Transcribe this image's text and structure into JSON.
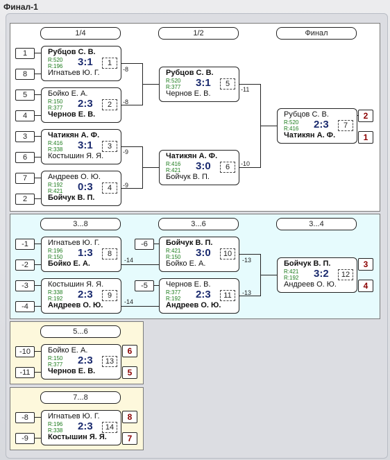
{
  "window_title": "Финал-1",
  "sec1": {
    "headers": [
      "1/4",
      "1/2",
      "Финал"
    ],
    "seeds": [
      "1",
      "8",
      "5",
      "4",
      "3",
      "6",
      "7",
      "2"
    ],
    "qf1": {
      "p1": "Рубцов С. В.",
      "p2": "Игнатьев Ю. Г.",
      "r1": "R:520",
      "r2": "R:196",
      "score": "3:1",
      "num": "1",
      "lbl": "-8"
    },
    "qf2": {
      "p1": "Бойко Е. А.",
      "p2": "Чернов Е. В.",
      "r1": "R:150",
      "r2": "R:377",
      "score": "2:3",
      "num": "2",
      "lbl": "-8"
    },
    "qf3": {
      "p1": "Чатикян А. Ф.",
      "p2": "Костышин Я. Я.",
      "r1": "R:416",
      "r2": "R:338",
      "score": "3:1",
      "num": "3",
      "lbl": "-9"
    },
    "qf4": {
      "p1": "Андреев О. Ю.",
      "p2": "Бойчук В. П.",
      "r1": "R:192",
      "r2": "R:421",
      "score": "0:3",
      "num": "4",
      "lbl": "-9"
    },
    "sf1": {
      "p1": "Рубцов С. В.",
      "p2": "Чернов Е. В.",
      "r1": "R:520",
      "r2": "R:377",
      "score": "3:1",
      "num": "5",
      "lbl": "-11"
    },
    "sf2": {
      "p1": "Чатикян А. Ф.",
      "p2": "Бойчук В. П.",
      "r1": "R:416",
      "r2": "R:421",
      "score": "3:0",
      "num": "6",
      "lbl": "-10"
    },
    "final": {
      "p1": "Рубцов С. В.",
      "p2": "Чатикян А. Ф.",
      "r1": "R:520",
      "r2": "R:416",
      "score": "2:3",
      "num": "7",
      "place1": "2",
      "place2": "1"
    }
  },
  "sec2": {
    "headers": [
      "3...8",
      "3...6",
      "3...4"
    ],
    "seeds": [
      "-1",
      "-2",
      "-3",
      "-4",
      "-6",
      "-5"
    ],
    "m8": {
      "p1": "Игнатьев Ю. Г.",
      "p2": "Бойко Е. А.",
      "r1": "R:196",
      "r2": "R:150",
      "score": "1:3",
      "num": "8",
      "lbl": "-14"
    },
    "m9": {
      "p1": "Костышин Я. Я.",
      "p2": "Андреев О. Ю.",
      "r1": "R:338",
      "r2": "R:192",
      "score": "2:3",
      "num": "9",
      "lbl": "-14"
    },
    "m10": {
      "p1": "Бойчук В. П.",
      "p2": "Бойко Е. А.",
      "r1": "R:421",
      "r2": "R:150",
      "score": "3:0",
      "num": "10",
      "lbl": "-13"
    },
    "m11": {
      "p1": "Чернов Е. В.",
      "p2": "Андреев О. Ю.",
      "r1": "R:377",
      "r2": "R:192",
      "score": "2:3",
      "num": "11",
      "lbl": "-13"
    },
    "m12": {
      "p1": "Бойчук В. П.",
      "p2": "Андреев О. Ю.",
      "r1": "R:421",
      "r2": "R:192",
      "score": "3:2",
      "num": "12",
      "place1": "3",
      "place2": "4"
    }
  },
  "sec3": {
    "header": "5...6",
    "seeds": [
      "-10",
      "-11"
    ],
    "m13": {
      "p1": "Бойко Е. А.",
      "p2": "Чернов Е. В.",
      "r1": "R:150",
      "r2": "R:377",
      "score": "2:3",
      "num": "13",
      "place1": "6",
      "place2": "5"
    }
  },
  "sec4": {
    "header": "7...8",
    "seeds": [
      "-8",
      "-9"
    ],
    "m14": {
      "p1": "Игнатьев Ю. Г.",
      "p2": "Костышин Я. Я.",
      "r1": "R:196",
      "r2": "R:338",
      "score": "2:3",
      "num": "14",
      "place1": "8",
      "place2": "7"
    }
  },
  "colors": {
    "sec1_bg": "#ffffff",
    "sec2_bg": "#e6fbfd",
    "sec3_bg": "#fdf8dc",
    "score": "#1a2a6e",
    "rating": "#1a7a1a",
    "place": "#8b0000"
  }
}
